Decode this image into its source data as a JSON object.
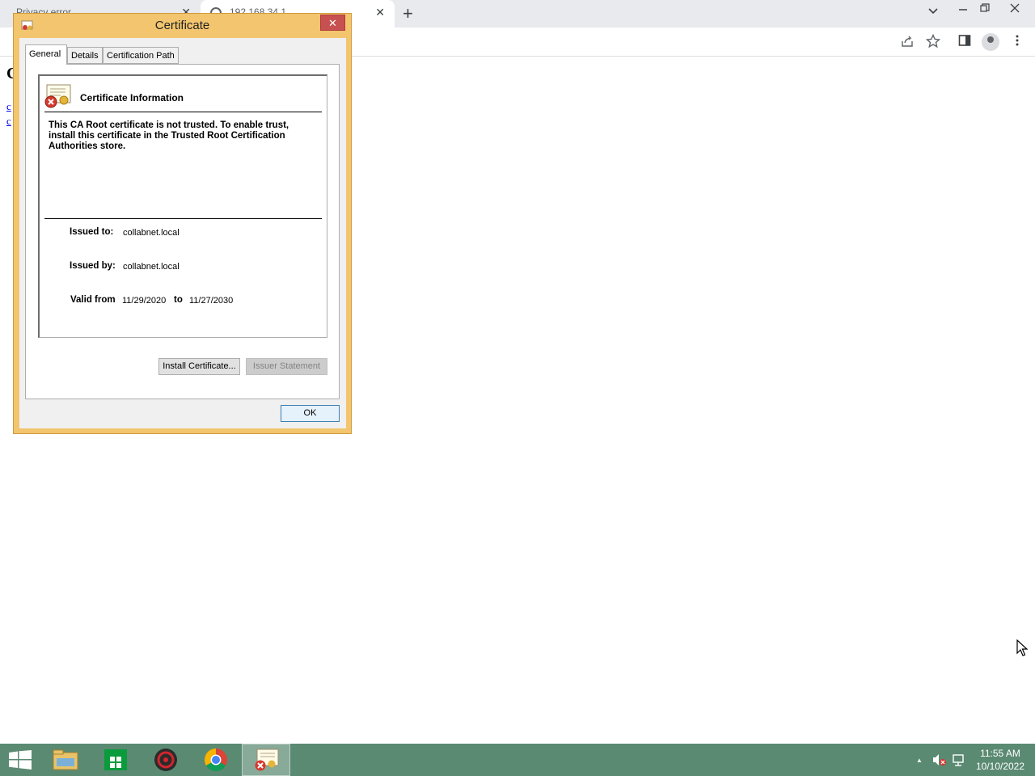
{
  "browser": {
    "tabs": [
      {
        "label": "Privacy error",
        "close": "✕"
      },
      {
        "label": "192.168.34.1",
        "close": "✕"
      }
    ],
    "new_tab": "+",
    "page": {
      "heading": "C",
      "links": [
        "c",
        "c"
      ]
    }
  },
  "dialog": {
    "title": "Certificate",
    "close": "✕",
    "tabs": [
      "General",
      "Details",
      "Certification Path"
    ],
    "info_title": "Certificate Information",
    "warning": "This CA Root certificate is not trusted. To enable trust, install this certificate in the Trusted Root Certification Authorities store.",
    "issued_to_label": "Issued to:",
    "issued_to": "collabnet.local",
    "issued_by_label": "Issued by:",
    "issued_by": "collabnet.local",
    "valid_from_label": "Valid from",
    "valid_from": "11/29/2020",
    "to_label": "to",
    "valid_to": "11/27/2030",
    "install_button": "Install Certificate...",
    "issuer_statement_button": "Issuer Statement",
    "ok_button": "OK"
  },
  "taskbar": {
    "time": "11:55 AM",
    "date": "10/10/2022",
    "tray_arrow": "▲"
  },
  "colors": {
    "dialog_frame": "#f2c56e",
    "taskbar": "#5b8a72",
    "close_button": "#c75050"
  }
}
